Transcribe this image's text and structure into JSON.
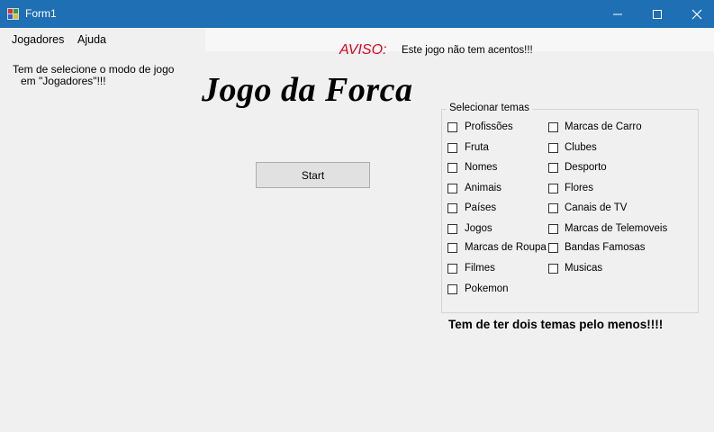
{
  "window": {
    "title": "Form1"
  },
  "menu": {
    "items": [
      "Jogadores",
      "Ajuda"
    ]
  },
  "warning": {
    "label": "AVISO:",
    "text": "Este jogo não tem acentos!!!"
  },
  "instruction": {
    "line1": "Tem de selecione o modo de jogo",
    "line2": "em \"Jogadores\"!!!"
  },
  "game_title": "Jogo da Forca",
  "start_button": "Start",
  "themes": {
    "caption": "Selecionar temas",
    "left": [
      "Profissões",
      "Fruta",
      "Nomes",
      "Animais",
      "Países",
      "Jogos",
      "Marcas de Roupa",
      "Filmes",
      "Pokemon"
    ],
    "right": [
      "Marcas de Carro",
      "Clubes",
      "Desporto",
      "Flores",
      "Canais de TV",
      "Marcas de Telemoveis",
      "Bandas Famosas",
      "Musicas"
    ]
  },
  "footer_note": "Tem de ter dois temas pelo menos!!!!",
  "colors": {
    "titlebar": "#1f6fb4",
    "warning": "#e0001a",
    "background": "#f0f0f0"
  }
}
